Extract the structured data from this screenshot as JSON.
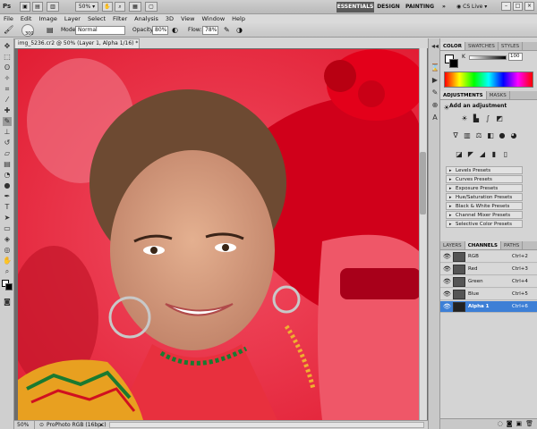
{
  "app": {
    "logo": "Ps",
    "workspaces": [
      "ESSENTIALS",
      "DESIGN",
      "PAINTING"
    ],
    "more": "»",
    "cslive": "CS Live",
    "zoom_select": "50%"
  },
  "menu": [
    "File",
    "Edit",
    "Image",
    "Layer",
    "Select",
    "Filter",
    "Analysis",
    "3D",
    "View",
    "Window",
    "Help"
  ],
  "options": {
    "brush_size": "300",
    "mode_label": "Mode:",
    "mode_value": "Normal",
    "opacity_label": "Opacity:",
    "opacity_value": "80%",
    "flow_label": "Flow:",
    "flow_value": "78%"
  },
  "document": {
    "tab_title": "img_5236.cr2 @ 50% (Layer 1, Alpha 1/16) *",
    "status_zoom": "50%",
    "status_profile": "ProPhoto RGB (16bpc)"
  },
  "panels": {
    "color_tabs": [
      "COLOR",
      "SWATCHES",
      "STYLES"
    ],
    "color_value": "100",
    "color_slider_label": "K",
    "adjust_tabs": [
      "ADJUSTMENTS",
      "MASKS"
    ],
    "adjust_title": "Add an adjustment",
    "presets": [
      "Levels Presets",
      "Curves Presets",
      "Exposure Presets",
      "Hue/Saturation Presets",
      "Black & White Presets",
      "Channel Mixer Presets",
      "Selective Color Presets"
    ],
    "layer_tabs": [
      "LAYERS",
      "CHANNELS",
      "PATHS"
    ],
    "channels": [
      {
        "name": "RGB",
        "key": "Ctrl+2"
      },
      {
        "name": "Red",
        "key": "Ctrl+3"
      },
      {
        "name": "Green",
        "key": "Ctrl+4"
      },
      {
        "name": "Blue",
        "key": "Ctrl+5"
      },
      {
        "name": "Alpha 1",
        "key": "Ctrl+6"
      }
    ]
  },
  "colors": {
    "mask_red": "#e3001a",
    "selection_blue": "#3d7fd6"
  }
}
